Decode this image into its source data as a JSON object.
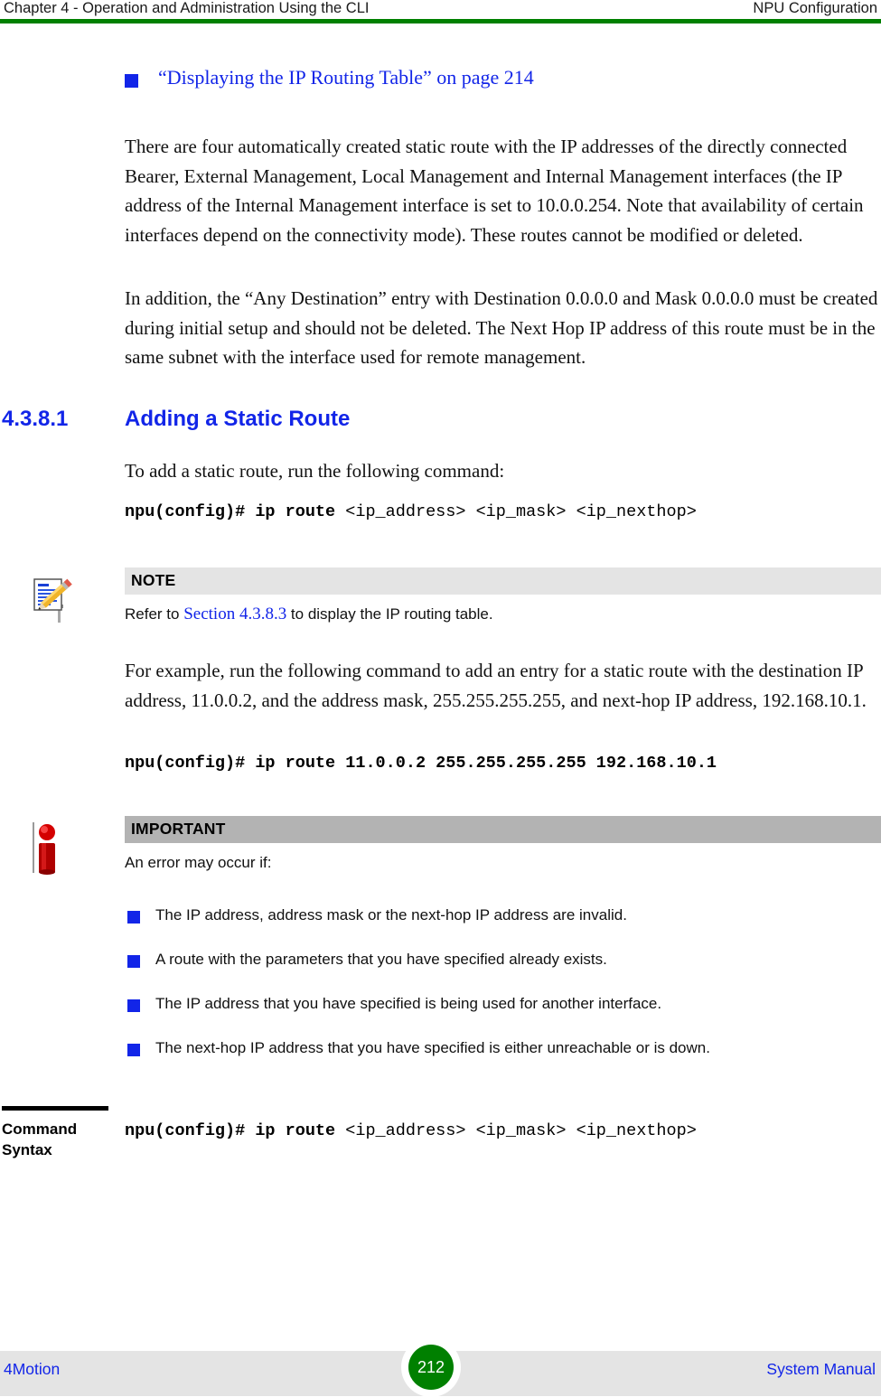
{
  "header": {
    "left": "Chapter 4 - Operation and Administration Using the CLI",
    "right": "NPU Configuration",
    "rule_color": "#008000"
  },
  "xref": {
    "bullet_icon": "blue-square-bullet",
    "label": "“Displaying the IP Routing Table” on page 214",
    "color": "#1225e8"
  },
  "paragraphs": {
    "p1": "There are four automatically created static route with the IP addresses of the directly connected Bearer, External Management, Local Management and Internal Management interfaces (the IP address of the Internal Management interface is set to 10.0.0.254. Note that availability of certain interfaces depend on the connectivity mode). These routes cannot be modified or deleted.",
    "p2": "In addition, the “Any Destination” entry with Destination 0.0.0.0 and Mask 0.0.0.0 must be created during initial setup and should not be deleted. The Next Hop IP address of this route must be in the same subnet with the interface used for remote management.",
    "p3": "To add a static route, run the following command:",
    "p4": "For example, run the following command to add an entry for a static route with the destination IP address, 11.0.0.2, and the address mask, 255.255.255.255, and next-hop IP address, 192.168.10.1."
  },
  "section": {
    "number": "4.3.8.1",
    "title": "Adding a Static Route",
    "color": "#1225e8"
  },
  "commands": {
    "syntax_prompt": "npu(config)# ip route ",
    "syntax_args": "<ip_address> <ip_mask> <ip_nexthop>",
    "example_prompt": "npu(config)# ip route ",
    "example_args": "11.0.0.2 255.255.255.255 192.168.10.1"
  },
  "note_box": {
    "icon": "note-pencil-icon",
    "title": "NOTE",
    "band_color": "#e4e4e4",
    "text_before_link": "Refer to ",
    "link_text": "Section 4.3.8.3",
    "text_after_link": " to display the IP routing table."
  },
  "important_box": {
    "icon": "important-info-icon",
    "title": "IMPORTANT",
    "band_color": "#b3b3b3",
    "intro": "An error may occur if:",
    "bullets": [
      "The IP address, address mask or the next-hop IP address are invalid.",
      "A route with the parameters that you have specified already exists.",
      "The IP address that you have specified is being used for another interface.",
      "The next-hop IP address that you have specified is either unreachable or is down."
    ]
  },
  "command_syntax_block": {
    "label_line1": "Command",
    "label_line2": "Syntax",
    "prompt": "npu(config)# ip route ",
    "args": "<ip_address> <ip_mask> <ip_nexthop>"
  },
  "footer": {
    "left": "4Motion",
    "page_number": "212",
    "right": "System Manual",
    "band_color": "#e4e4e4",
    "page_badge_color": "#008000"
  }
}
